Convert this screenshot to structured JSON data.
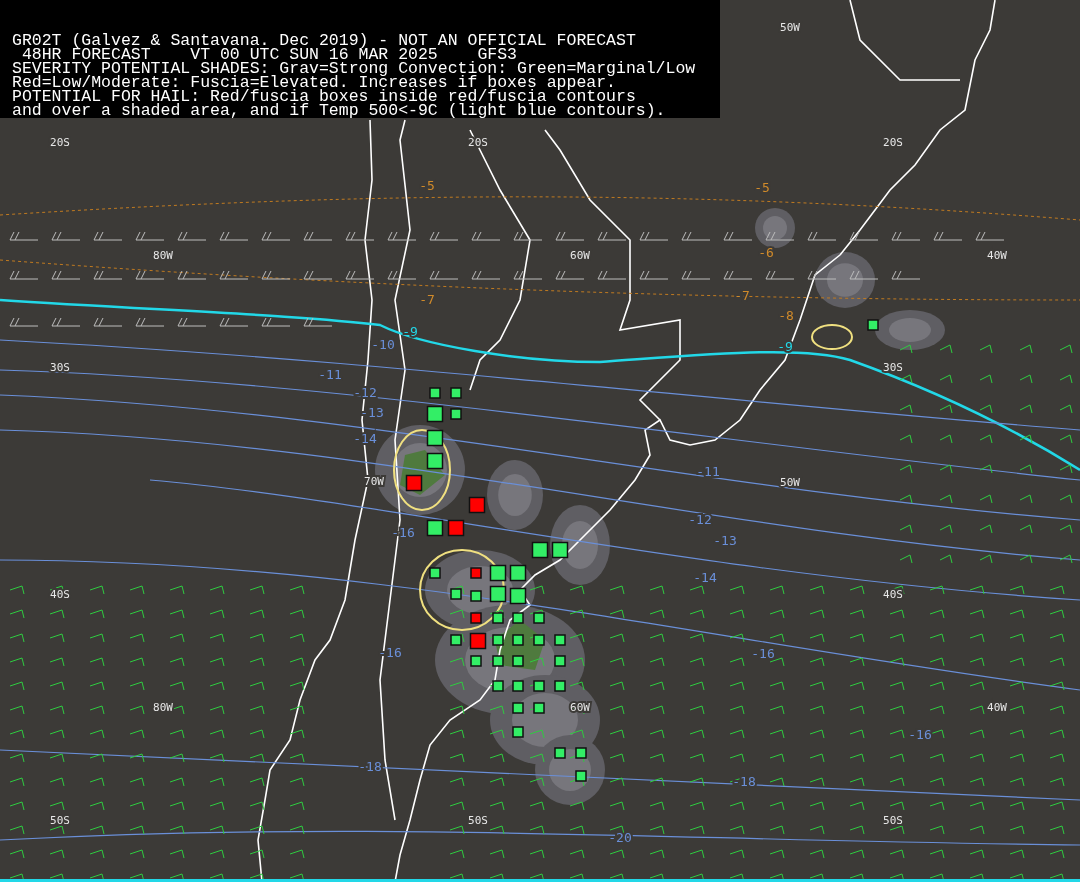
{
  "header": {
    "lines": [
      "GR02T (Galvez & Santavana. Dec 2019) - NOT AN OFFICIAL FORECAST",
      " 48HR FORECAST    VT 00 UTC SUN 16 MAR 2025    GFS3",
      "SEVERITY POTENTIAL SHADES: Grav=Strong Convection: Green=Marginal/Low",
      "Red=Low/Moderate: Fuscia=Elevated. Increases if boxes appear.",
      "POTENTIAL FOR HAIL: Red/fuscia boxes inside red/fuscia contours",
      "and over a shaded area, and if Temp 500<-9C (light blue contours)."
    ]
  },
  "map": {
    "grid_labels": [
      "50W",
      "20S",
      "20S",
      "20S",
      "80W",
      "60W",
      "40W",
      "30S",
      "30S",
      "70W",
      "50W",
      "40S",
      "40S",
      "80W",
      "60W",
      "40W",
      "50S",
      "50S",
      "50S"
    ],
    "contour_labels": [
      {
        "text": "-5",
        "color": "#d08a2a"
      },
      {
        "text": "-5",
        "color": "#d08a2a"
      },
      {
        "text": "-6",
        "color": "#d08a2a"
      },
      {
        "text": "-7",
        "color": "#d08a2a"
      },
      {
        "text": "-7",
        "color": "#d08a2a"
      },
      {
        "text": "-8",
        "color": "#d08a2a"
      },
      {
        "text": "-9",
        "color": "#22d8e8"
      },
      {
        "text": "-9",
        "color": "#22d8e8"
      },
      {
        "text": "-10",
        "color": "#6a8fd8"
      },
      {
        "text": "-11",
        "color": "#6a8fd8"
      },
      {
        "text": "-12",
        "color": "#6a8fd8"
      },
      {
        "text": "-13",
        "color": "#6a8fd8"
      },
      {
        "text": "-14",
        "color": "#6a8fd8"
      },
      {
        "text": "-11",
        "color": "#6a8fd8"
      },
      {
        "text": "-12",
        "color": "#6a8fd8"
      },
      {
        "text": "-13",
        "color": "#6a8fd8"
      },
      {
        "text": "-14",
        "color": "#6a8fd8"
      },
      {
        "text": "-16",
        "color": "#6a8fd8"
      },
      {
        "text": "-16",
        "color": "#6a8fd8"
      },
      {
        "text": "-16",
        "color": "#6a8fd8"
      },
      {
        "text": "-16",
        "color": "#6a8fd8"
      },
      {
        "text": "-18",
        "color": "#6a8fd8"
      },
      {
        "text": "-18",
        "color": "#6a8fd8"
      },
      {
        "text": "-20",
        "color": "#6a8fd8"
      }
    ],
    "hail_boxes": [
      {
        "color": "#33ee66",
        "kind": "small"
      },
      {
        "color": "#33ee66",
        "kind": "small"
      },
      {
        "color": "#33ee66",
        "kind": "large"
      },
      {
        "color": "#33ee66",
        "kind": "small"
      },
      {
        "color": "#33ee66",
        "kind": "large"
      },
      {
        "color": "#33ee66",
        "kind": "large"
      },
      {
        "color": "#ff0000",
        "kind": "large"
      },
      {
        "color": "#ff0000",
        "kind": "large"
      },
      {
        "color": "#33ee66",
        "kind": "large"
      },
      {
        "color": "#ff0000",
        "kind": "large"
      },
      {
        "color": "#33ee66",
        "kind": "large"
      },
      {
        "color": "#33ee66",
        "kind": "large"
      },
      {
        "color": "#33ee66",
        "kind": "small"
      },
      {
        "color": "#ff0000",
        "kind": "small"
      },
      {
        "color": "#33ee66",
        "kind": "large"
      },
      {
        "color": "#33ee66",
        "kind": "large"
      },
      {
        "color": "#33ee66",
        "kind": "small"
      },
      {
        "color": "#33ee66",
        "kind": "small"
      },
      {
        "color": "#33ee66",
        "kind": "large"
      },
      {
        "color": "#33ee66",
        "kind": "large"
      },
      {
        "color": "#ff0000",
        "kind": "small"
      },
      {
        "color": "#33ee66",
        "kind": "small"
      },
      {
        "color": "#33ee66",
        "kind": "small"
      },
      {
        "color": "#33ee66",
        "kind": "small"
      },
      {
        "color": "#33ee66",
        "kind": "small"
      },
      {
        "color": "#ff0000",
        "kind": "large"
      },
      {
        "color": "#33ee66",
        "kind": "small"
      },
      {
        "color": "#33ee66",
        "kind": "small"
      },
      {
        "color": "#33ee66",
        "kind": "small"
      },
      {
        "color": "#33ee66",
        "kind": "small"
      },
      {
        "color": "#33ee66",
        "kind": "small"
      },
      {
        "color": "#33ee66",
        "kind": "small"
      },
      {
        "color": "#33ee66",
        "kind": "small"
      },
      {
        "color": "#33ee66",
        "kind": "small"
      },
      {
        "color": "#33ee66",
        "kind": "small"
      },
      {
        "color": "#33ee66",
        "kind": "small"
      },
      {
        "color": "#33ee66",
        "kind": "small"
      },
      {
        "color": "#33ee66",
        "kind": "small"
      },
      {
        "color": "#33ee66",
        "kind": "small"
      },
      {
        "color": "#33ee66",
        "kind": "small"
      },
      {
        "color": "#33ee66",
        "kind": "small"
      },
      {
        "color": "#33ee66",
        "kind": "small"
      },
      {
        "color": "#33ee66",
        "kind": "small"
      },
      {
        "color": "#33ee66",
        "kind": "small"
      },
      {
        "color": "#33ee66",
        "kind": "small"
      }
    ]
  }
}
